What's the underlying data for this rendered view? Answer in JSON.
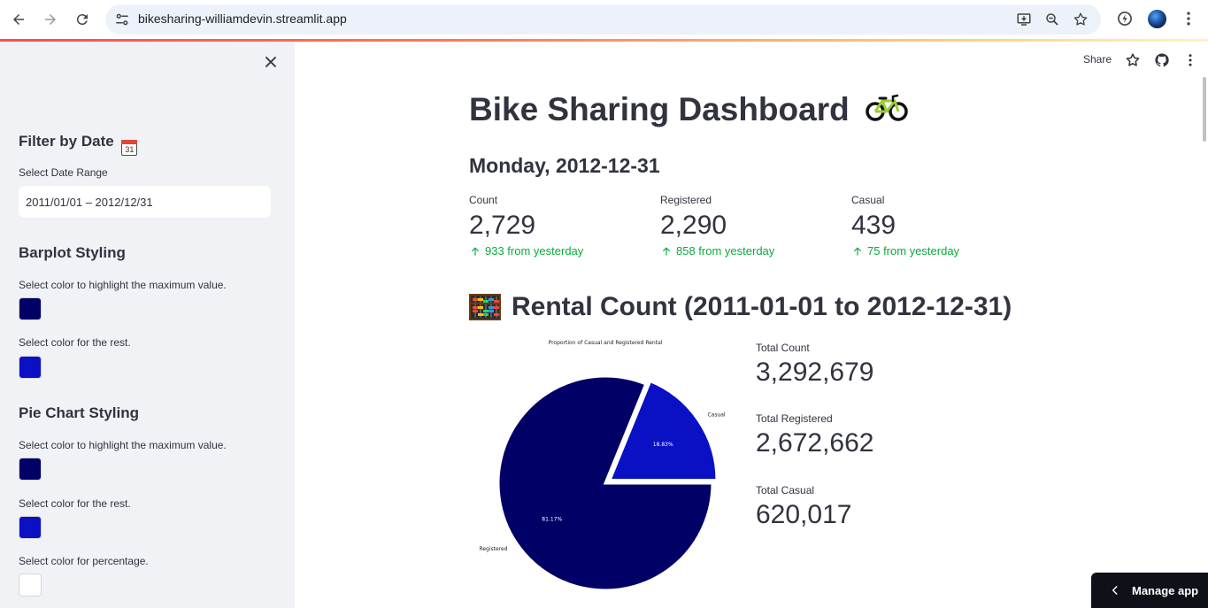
{
  "browser": {
    "url": "bikesharing-williamdevin.streamlit.app"
  },
  "sidebar": {
    "filter_heading": "Filter by Date",
    "calendar_day": "31",
    "date_range_label": "Select Date Range",
    "date_range_value": "2011/01/01 – 2012/12/31",
    "barplot_heading": "Barplot Styling",
    "barplot_max_label": "Select color to highlight the maximum value.",
    "barplot_max_color": "#000066",
    "barplot_rest_label": "Select color for the rest.",
    "barplot_rest_color": "#0a10c4",
    "pie_heading": "Pie Chart Styling",
    "pie_max_label": "Select color to highlight the maximum value.",
    "pie_max_color": "#000066",
    "pie_rest_label": "Select color for the rest.",
    "pie_rest_color": "#0a10c4",
    "pie_pct_label": "Select color for percentage.",
    "pie_pct_color": "#ffffff"
  },
  "toolbar": {
    "share_label": "Share"
  },
  "main": {
    "title": "Bike Sharing Dashboard",
    "date_heading": "Monday, 2012-12-31",
    "metrics": [
      {
        "label": "Count",
        "value": "2,729",
        "delta": "933 from yesterday"
      },
      {
        "label": "Registered",
        "value": "2,290",
        "delta": "858 from yesterday"
      },
      {
        "label": "Casual",
        "value": "439",
        "delta": "75 from yesterday"
      }
    ],
    "section_title": "Rental Count (2011-01-01 to 2012-12-31)",
    "totals": [
      {
        "label": "Total Count",
        "value": "3,292,679"
      },
      {
        "label": "Total Registered",
        "value": "2,672,662"
      },
      {
        "label": "Total Casual",
        "value": "620,017"
      }
    ]
  },
  "chart_data": {
    "type": "pie",
    "title": "Proportion of Casual and Registered Rental",
    "categories": [
      "Casual",
      "Registered"
    ],
    "values": [
      18.83,
      81.17
    ],
    "value_labels": [
      "18.83%",
      "81.17%"
    ],
    "colors": [
      "#0a10c4",
      "#000066"
    ],
    "explode": "Casual",
    "label_color": "#ffffff"
  },
  "footer": {
    "manage_app_label": "Manage app"
  }
}
